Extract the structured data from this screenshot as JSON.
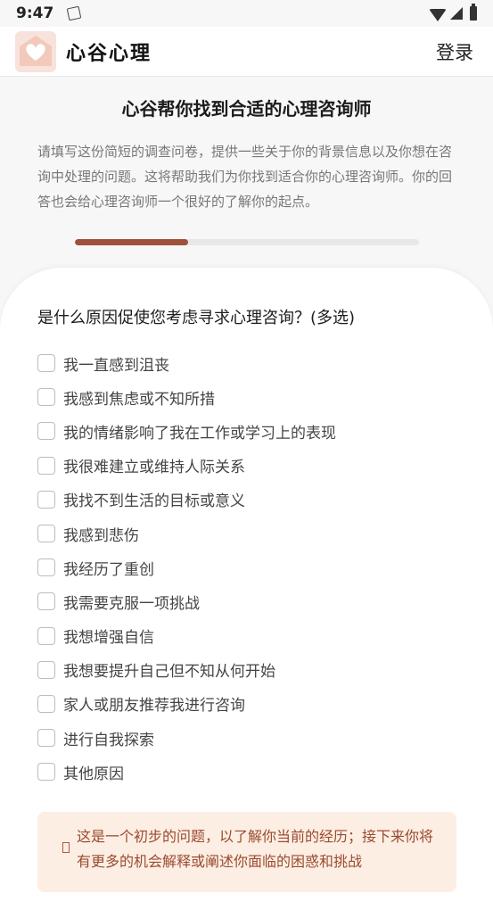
{
  "status_bar": {
    "time": "9:47"
  },
  "header": {
    "brand_name": "心谷心理",
    "login_label": "登录"
  },
  "hero": {
    "title": "心谷帮你找到合适的心理咨询师",
    "description": "请填写这份简短的调查问卷，提供一些关于你的背景信息以及你想在咨询中处理的问题。这将帮助我们为你找到适合你的心理咨询师。你的回答也会给心理咨询师一个很好的了解你的起点。",
    "progress": 0.33
  },
  "survey": {
    "question": "是什么原因促使您考虑寻求心理咨询？(多选)",
    "options": [
      "我一直感到沮丧",
      "我感到焦虑或不知所措",
      "我的情绪影响了我在工作或学习上的表现",
      "我很难建立或维持人际关系",
      "我找不到生活的目标或意义",
      "我感到悲伤",
      "我经历了重创",
      "我需要克服一项挑战",
      "我想增强自信",
      "我想要提升自己但不知从何开始",
      "家人或朋友推荐我进行咨询",
      "进行自我探索",
      "其他原因"
    ],
    "notice": "这是一个初步的问题，以了解你当前的经历；接下来你将有更多的机会解释或阐述你面临的困惑和挑战"
  },
  "colors": {
    "accent": "#a0503a",
    "notice_bg": "#fdeee3",
    "notice_text": "#9a4b30"
  }
}
